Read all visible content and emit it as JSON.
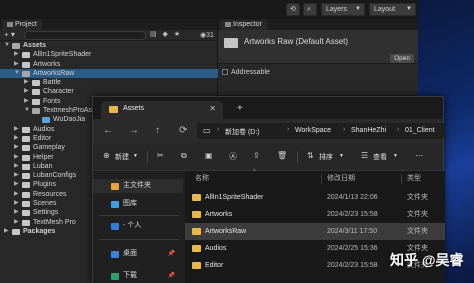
{
  "topbar": {
    "layers_label": "Layers",
    "layout_label": "Layout"
  },
  "project": {
    "tab_label": "Project",
    "hidden_count": "31",
    "tree": [
      {
        "label": "Assets",
        "indent": 0,
        "arrow": "▼",
        "bold": true
      },
      {
        "label": "AllIn1SpriteShader",
        "indent": 1,
        "arrow": "▶"
      },
      {
        "label": "Artworks",
        "indent": 1,
        "arrow": "▶"
      },
      {
        "label": "ArtworksRaw",
        "indent": 1,
        "arrow": "▼",
        "selected": true
      },
      {
        "label": "Battle",
        "indent": 2,
        "arrow": "▶"
      },
      {
        "label": "Character",
        "indent": 2,
        "arrow": "▶"
      },
      {
        "label": "Fonts",
        "indent": 2,
        "arrow": "▶"
      },
      {
        "label": "TextmeshProAsse",
        "indent": 2,
        "arrow": "▼"
      },
      {
        "label": "WuDaoJia",
        "indent": 3,
        "arrow": "",
        "blue": true
      },
      {
        "label": "Audios",
        "indent": 1,
        "arrow": "▶"
      },
      {
        "label": "Editor",
        "indent": 1,
        "arrow": "▶"
      },
      {
        "label": "Gameplay",
        "indent": 1,
        "arrow": "▶"
      },
      {
        "label": "Helper",
        "indent": 1,
        "arrow": "▶"
      },
      {
        "label": "Luban",
        "indent": 1,
        "arrow": "▶"
      },
      {
        "label": "LubanConfigs",
        "indent": 1,
        "arrow": "▶"
      },
      {
        "label": "Plugins",
        "indent": 1,
        "arrow": "▶"
      },
      {
        "label": "Resources",
        "indent": 1,
        "arrow": "▶"
      },
      {
        "label": "Scenes",
        "indent": 1,
        "arrow": "▶"
      },
      {
        "label": "Settings",
        "indent": 1,
        "arrow": "▶"
      },
      {
        "label": "TextMesh Pro",
        "indent": 1,
        "arrow": "▶"
      },
      {
        "label": "Packages",
        "indent": 0,
        "arrow": "▶",
        "bold": true
      }
    ]
  },
  "inspector": {
    "tab_label": "Inspector",
    "title": "Artworks Raw (Default Asset)",
    "open_label": "Open",
    "addressable_label": "Addressable"
  },
  "explorer": {
    "tab_title": "Assets",
    "breadcrumbs": [
      "新加卷 (D:)",
      "WorkSpace",
      "ShanHeZhi",
      "01_Client"
    ],
    "commands": {
      "new_label": "新建",
      "sort_label": "排序",
      "view_label": "查看"
    },
    "sidebar": [
      {
        "label": "主文件夹",
        "color": "#e8a040",
        "selected": true
      },
      {
        "label": "图库",
        "color": "#3aa0e0"
      },
      {
        "label": "- 个人",
        "color": "#2f7fd8"
      },
      {
        "label": "桌面",
        "color": "#3a7fd8",
        "pinned": true
      },
      {
        "label": "下载",
        "color": "#2ea06a",
        "pinned": true
      }
    ],
    "columns": {
      "name": "名称",
      "modified": "修改日期",
      "type": "类型"
    },
    "files": [
      {
        "name": "AllIn1SpriteShader",
        "modified": "2024/1/13 22:06",
        "type": "文件夹"
      },
      {
        "name": "Artworks",
        "modified": "2024/2/23 15:58",
        "type": "文件夹"
      },
      {
        "name": "ArtworksRaw",
        "modified": "2024/3/11 17:50",
        "type": "文件夹",
        "selected": true
      },
      {
        "name": "Audios",
        "modified": "2024/2/25 15:36",
        "type": "文件夹"
      },
      {
        "name": "Editor",
        "modified": "2024/2/23 15:58",
        "type": "文件夹"
      }
    ]
  },
  "watermark": "知乎 @吴睿"
}
